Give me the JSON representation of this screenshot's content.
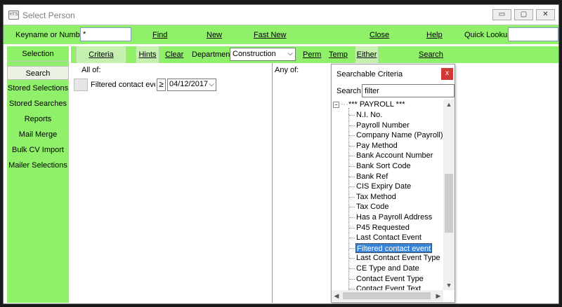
{
  "window": {
    "title": "Select Person",
    "icon_name": "app-icon",
    "controls": {
      "minimize": "▭",
      "maximize": "▢",
      "close": "✕"
    }
  },
  "toolbar": {
    "keyname_label": "Keyname or Number",
    "keyname_value": "*",
    "find": "Find",
    "new": "New",
    "fast_new": "Fast New",
    "close": "Close",
    "help": "Help",
    "quick_lookup_label": "Quick Lookup",
    "quick_lookup_value": ""
  },
  "colors": {
    "accent_green": "#90f06a",
    "tab_green": "#c5f0b0",
    "selected_blue": "#3a84d7",
    "close_red": "#cf3a34"
  },
  "sidebar": {
    "header": "Selection",
    "items": [
      {
        "label": "Search",
        "active": true
      },
      {
        "label": "Stored Selections"
      },
      {
        "label": "Stored Searches"
      },
      {
        "label": "Reports"
      },
      {
        "label": "Mail Merge"
      },
      {
        "label": "Bulk CV Import"
      },
      {
        "label": "Mailer Selections"
      }
    ]
  },
  "subbar": {
    "criteria": "Criteria",
    "hints": "Hints",
    "clear": "Clear",
    "department_label": "Department",
    "department_value": "Construction",
    "perm": "Perm",
    "temp": "Temp",
    "either": "Either",
    "search": "Search"
  },
  "criteria_panel": {
    "all_of_label": "All of:",
    "any_of_label": "Any of:",
    "row": {
      "name": "Filtered contact event",
      "operator": "≥",
      "date": "04/12/2017"
    }
  },
  "popup": {
    "title": "Searchable Criteria",
    "close": "x",
    "search_label": "Search",
    "search_value": "filter",
    "root_label": "*** PAYROLL ***",
    "items": [
      "N.I. No.",
      "Payroll Number",
      "Company Name (Payroll)",
      "Pay Method",
      "Bank Account Number",
      "Bank Sort Code",
      "Bank Ref",
      "CIS Expiry Date",
      "Tax Method",
      "Tax Code",
      "Has a Payroll Address",
      "P45 Requested",
      "Last Contact Event",
      "Filtered contact event",
      "Last Contact Event Type",
      "CE Type and Date",
      "Contact Event Type",
      "Contact Event Text"
    ],
    "selected_index": 13
  }
}
